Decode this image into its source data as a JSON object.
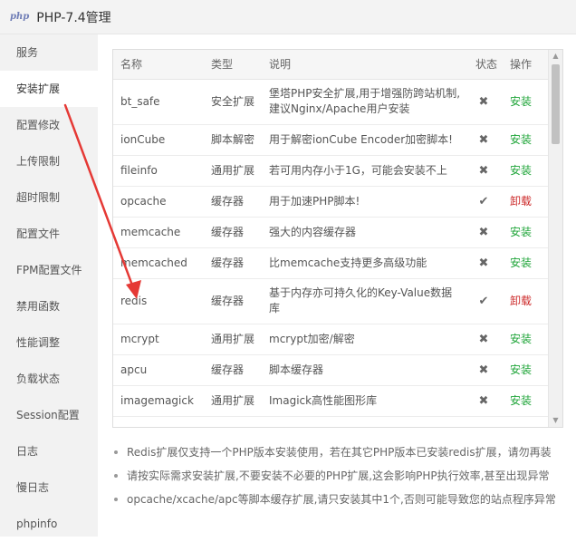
{
  "window": {
    "logo": "php",
    "title": "PHP-7.4管理"
  },
  "sidebar": {
    "items": [
      {
        "label": "服务"
      },
      {
        "label": "安装扩展",
        "active": true
      },
      {
        "label": "配置修改"
      },
      {
        "label": "上传限制"
      },
      {
        "label": "超时限制"
      },
      {
        "label": "配置文件"
      },
      {
        "label": "FPM配置文件"
      },
      {
        "label": "禁用函数"
      },
      {
        "label": "性能调整"
      },
      {
        "label": "负载状态"
      },
      {
        "label": "Session配置"
      },
      {
        "label": "日志"
      },
      {
        "label": "慢日志"
      },
      {
        "label": "phpinfo"
      }
    ]
  },
  "table": {
    "headers": {
      "name": "名称",
      "type": "类型",
      "desc": "说明",
      "status": "状态",
      "op": "操作"
    },
    "rows": [
      {
        "name": "bt_safe",
        "type": "安全扩展",
        "desc": "堡塔PHP安全扩展,用于增强防跨站机制,建议Nginx/Apache用户安装",
        "status": "✖",
        "op": "安装",
        "installed": false
      },
      {
        "name": "ionCube",
        "type": "脚本解密",
        "desc": "用于解密ionCube Encoder加密脚本!",
        "status": "✖",
        "op": "安装",
        "installed": false
      },
      {
        "name": "fileinfo",
        "type": "通用扩展",
        "desc": "若可用内存小于1G，可能会安装不上",
        "status": "✖",
        "op": "安装",
        "installed": false
      },
      {
        "name": "opcache",
        "type": "缓存器",
        "desc": "用于加速PHP脚本!",
        "status": "✔",
        "op": "卸载",
        "installed": true
      },
      {
        "name": "memcache",
        "type": "缓存器",
        "desc": "强大的内容缓存器",
        "status": "✖",
        "op": "安装",
        "installed": false
      },
      {
        "name": "memcached",
        "type": "缓存器",
        "desc": "比memcache支持更多高级功能",
        "status": "✖",
        "op": "安装",
        "installed": false
      },
      {
        "name": "redis",
        "type": "缓存器",
        "desc": "基于内存亦可持久化的Key-Value数据库",
        "status": "✔",
        "op": "卸载",
        "installed": true
      },
      {
        "name": "mcrypt",
        "type": "通用扩展",
        "desc": "mcrypt加密/解密",
        "status": "✖",
        "op": "安装",
        "installed": false
      },
      {
        "name": "apcu",
        "type": "缓存器",
        "desc": "脚本缓存器",
        "status": "✖",
        "op": "安装",
        "installed": false
      },
      {
        "name": "imagemagick",
        "type": "通用扩展",
        "desc": "Imagick高性能图形库",
        "status": "✖",
        "op": "安装",
        "installed": false
      }
    ]
  },
  "notes": [
    "Redis扩展仅支持一个PHP版本安装使用，若在其它PHP版本已安装redis扩展，请勿再装",
    "请按实际需求安装扩展,不要安装不必要的PHP扩展,这会影响PHP执行效率,甚至出现异常",
    "opcache/xcache/apc等脚本缓存扩展,请只安装其中1个,否则可能导致您的站点程序异常"
  ],
  "colors": {
    "install": "#20a53a",
    "uninstall": "#cc2a2a",
    "annotation_arrow": "#e53935"
  }
}
